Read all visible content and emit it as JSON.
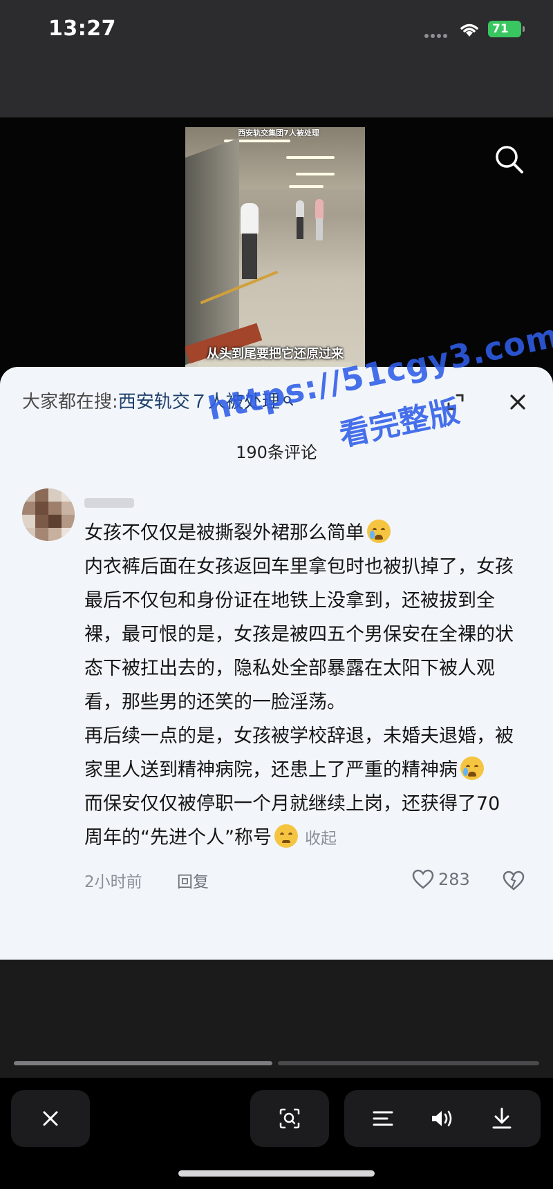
{
  "status_bar": {
    "time": "13:27",
    "battery": "71"
  },
  "video": {
    "caption_top": "西安轨交集团7人被处理",
    "caption": "从头到尾要把它还原过来"
  },
  "sheet": {
    "search_hint_label": "大家都在搜:",
    "search_hint_query": "西安轨交７人被处理",
    "comment_count": "190条评论"
  },
  "watermark": {
    "url": "https://51cgy3.com",
    "text": "看完整版"
  },
  "comment": {
    "lines": [
      "女孩不仅仅是被撕裂外裙那么简单",
      "内衣裤后面在女孩返回车里拿包时也被扒掉了，女孩最后不仅包和身份证在地铁上没拿到，还被拔到全裸，最可恨的是，女孩是被四五个男保安在全裸的状态下被扛出去的，隐私处全部暴露在太阳下被人观看，那些男的还笑的一脸淫荡。",
      "再后续一点的是，女孩被学校辞退，未婚夫退婚，被家里人送到精神病院，还患上了严重的精神病",
      "而保安仅仅被停职一个月就继续上岗，还获得了70周年的“先进个人”称号"
    ],
    "collapse_label": "收起",
    "time": "2小时前",
    "reply_label": "回复",
    "like_count": "283"
  },
  "colors": {
    "sheet_bg": "#f2f6fa",
    "query_color": "#1e3f6b",
    "watermark_color": "#2f5de8",
    "battery_green": "#39c660"
  },
  "icons": [
    "search-icon",
    "expand-icon",
    "close-icon",
    "heart-icon",
    "dislike-icon",
    "lens-icon",
    "list-icon",
    "speaker-icon",
    "download-icon"
  ]
}
